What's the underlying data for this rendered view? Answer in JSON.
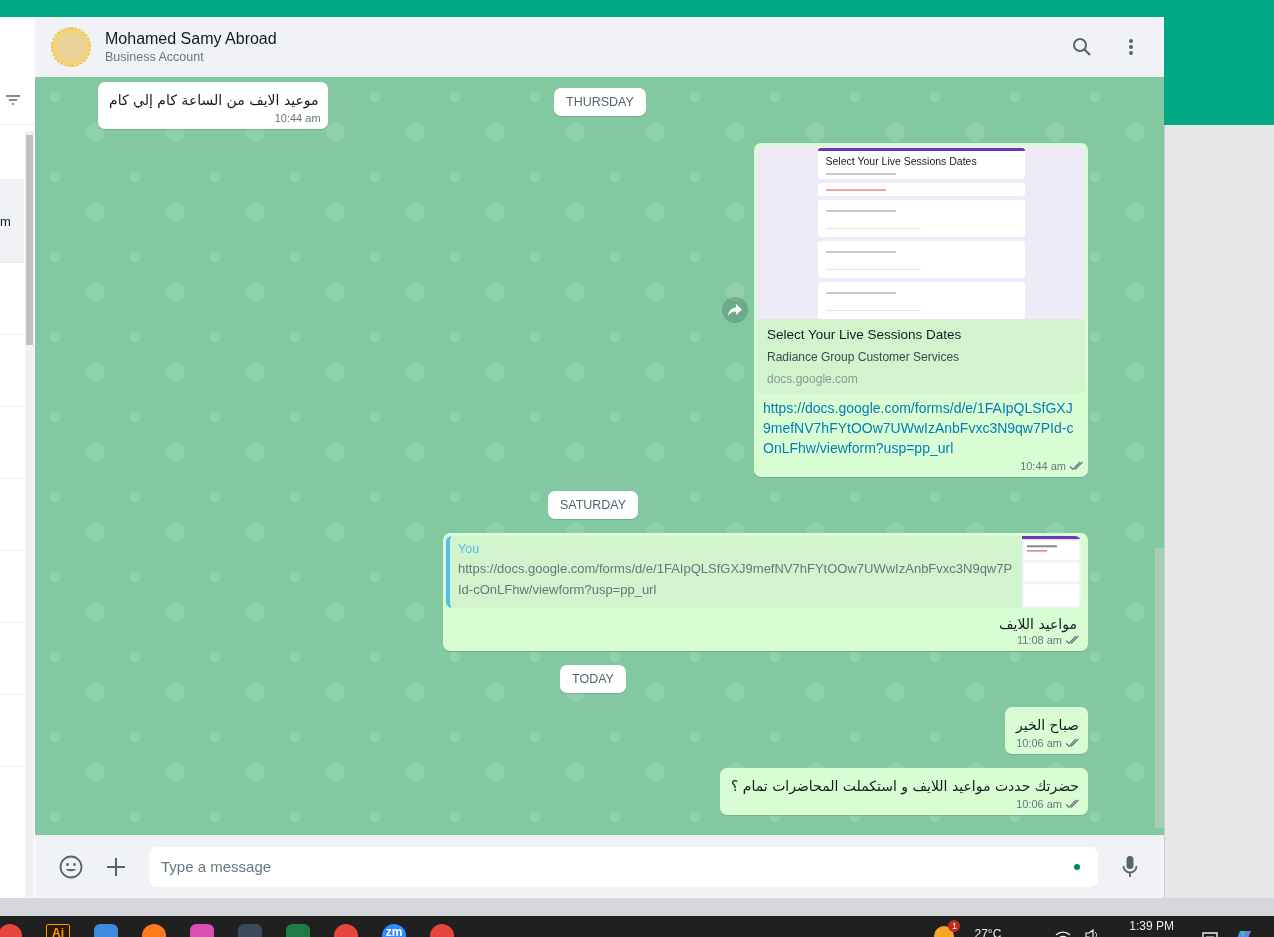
{
  "sidebar_fragment": {
    "row_text": "m"
  },
  "chat": {
    "contact": {
      "name": "Mohamed Samy Abroad",
      "subtitle": "Business Account"
    },
    "sticky_day": "THURSDAY",
    "messages": [
      {
        "kind": "text",
        "outgoing": false,
        "text": "موعيد الايف من الساعة كام إلي كام",
        "time": "10:44 am"
      },
      {
        "kind": "link",
        "outgoing": true,
        "preview": {
          "form_title": "Select Your Live Sessions Dates",
          "title": "Select Your Live Sessions Dates",
          "subtitle": "Radiance Group Customer Services",
          "domain": "docs.google.com"
        },
        "url": "https://docs.google.com/forms/d/e/1FAIpQLSfGXJ9mefNV7hFYtOOw7UWwIzAnbFvxc3N9qw7PId-cOnLFhw/viewform?usp=pp_url",
        "time": "10:44 am",
        "read": false
      },
      {
        "kind": "day",
        "label": "SATURDAY"
      },
      {
        "kind": "reply",
        "outgoing": true,
        "quote": {
          "author": "You",
          "text": "https://docs.google.com/forms/d/e/1FAIpQLSfGXJ9mefNV7hFYtOOw7UWwIzAnbFvxc3N9qw7PId-cOnLFhw/viewform?usp=pp_url"
        },
        "text": "مواعيد اللايف",
        "time": "11:08 am",
        "read": false
      },
      {
        "kind": "day",
        "label": "TODAY"
      },
      {
        "kind": "text",
        "outgoing": true,
        "text": "صباح الخير",
        "time": "10:06 am",
        "read": false
      },
      {
        "kind": "text",
        "outgoing": true,
        "text": "حضرتك حددت مواعيد اللايف و استكملت المحاضرات تمام ؟",
        "time": "10:06 am",
        "read": false
      }
    ],
    "composer": {
      "placeholder": "Type a message"
    }
  },
  "taskbar": {
    "apps": [
      {
        "kind": "chrome"
      },
      {
        "kind": "illustrator",
        "label": "Ai"
      },
      {
        "kind": "photos"
      },
      {
        "kind": "firefox"
      },
      {
        "kind": "pink"
      },
      {
        "kind": "dark"
      },
      {
        "kind": "excel"
      },
      {
        "kind": "chrome"
      },
      {
        "kind": "zoom",
        "label": "zm"
      },
      {
        "kind": "chrome"
      }
    ],
    "weather_badge": "1",
    "temperature": "27°C",
    "time": "1:39 PM"
  }
}
